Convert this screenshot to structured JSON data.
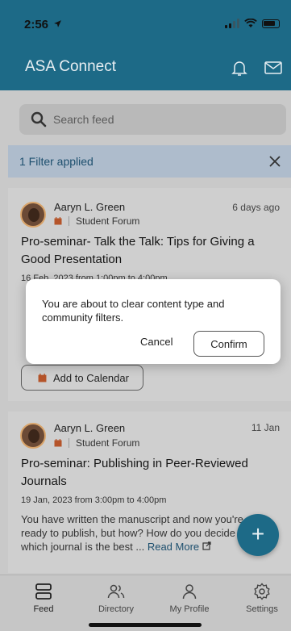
{
  "status_bar": {
    "time": "2:56"
  },
  "header": {
    "title": "ASA Connect"
  },
  "search": {
    "placeholder": "Search feed"
  },
  "filter": {
    "label": "1 Filter applied"
  },
  "posts": [
    {
      "author": "Aaryn L. Green",
      "forum": "Student Forum",
      "when": "6 days ago",
      "title": "Pro-seminar- Talk the Talk: Tips for Giving a Good Presentation",
      "date": "16 Feb, 2023 from 1:00pm to 4:00pm",
      "calendar_button": "Add to Calendar"
    },
    {
      "author": "Aaryn L. Green",
      "forum": "Student Forum",
      "when": "11 Jan",
      "title": "Pro-seminar: Publishing in Peer-Reviewed Journals",
      "date": "19 Jan, 2023 from 3:00pm to 4:00pm",
      "snippet": "You have written the manuscript and now you're ready to publish, but how? How do you decide which journal is the best ...",
      "read_more": "Read More"
    }
  ],
  "fab": {
    "label": "+"
  },
  "dialog": {
    "message": "You are about to clear content type and community filters.",
    "cancel": "Cancel",
    "confirm": "Confirm"
  },
  "tabs": [
    {
      "label": "Feed"
    },
    {
      "label": "Directory"
    },
    {
      "label": "My Profile"
    },
    {
      "label": "Settings"
    }
  ],
  "colors": {
    "brand": "#1d6a87",
    "filter_bar": "#aebccc"
  }
}
